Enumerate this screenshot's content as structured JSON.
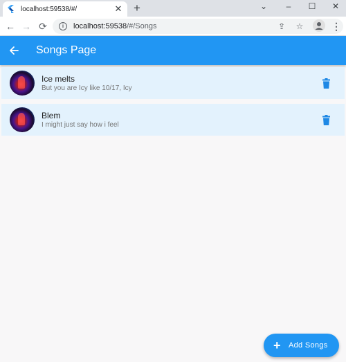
{
  "browser": {
    "tab_title": "localhost:59538/#/",
    "tab_close": "✕",
    "new_tab": "+",
    "window_controls": {
      "chevron": "⌄",
      "minimize": "–",
      "maximize": "☐",
      "close": "✕"
    },
    "url_host": "localhost:59538",
    "url_path": "/#/Songs",
    "icons": {
      "back": "←",
      "forward": "→",
      "reload": "⟳",
      "share": "⇪",
      "star": "☆",
      "menu": "⋮"
    }
  },
  "appbar": {
    "title": "Songs Page",
    "color": "#2196f3"
  },
  "songs": [
    {
      "title": "Ice melts",
      "subtitle": "But you are Icy like 10/17, Icy"
    },
    {
      "title": "Blem",
      "subtitle": "I might just say how i feel"
    }
  ],
  "fab": {
    "icon": "+",
    "label": "Add Songs"
  },
  "colors": {
    "accent": "#2196f3",
    "row_background": "#e3f2fd",
    "page_background": "#f8f7f8"
  }
}
